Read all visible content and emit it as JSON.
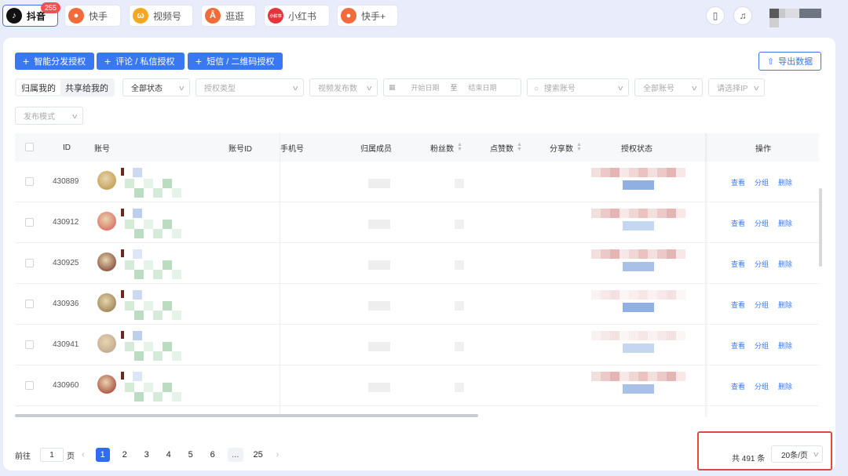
{
  "platforms": [
    {
      "label": "抖音",
      "icon": "douyin-icon",
      "badge": "255",
      "active": true,
      "color": "#111111"
    },
    {
      "label": "快手",
      "icon": "kuaishou-icon",
      "active": false,
      "color": "#f26b3a"
    },
    {
      "label": "视频号",
      "icon": "wechat-channels-icon",
      "active": false,
      "color": "#f5a623"
    },
    {
      "label": "逛逛",
      "icon": "guangguang-icon",
      "active": false,
      "color": "#f26b3a"
    },
    {
      "label": "小红书",
      "icon": "xiaohongshu-icon",
      "icon_text": "小红书",
      "active": false,
      "color": "#e8323c"
    },
    {
      "label": "快手+",
      "icon": "kuaishou-plus-icon",
      "active": false,
      "color": "#f26b3a"
    }
  ],
  "toolbar": {
    "btn_smart": "智能分发授权",
    "btn_comment": "评论 / 私信授权",
    "btn_sms": "短信 / 二维码授权",
    "export": "导出数据"
  },
  "filters": {
    "seg_mine": "归属我的",
    "seg_shared": "共享给我的",
    "status": "全部状态",
    "auth_type": "授权类型",
    "video_count": "视频发布数",
    "start_date": "开始日期",
    "to": "至",
    "end_date": "结束日期",
    "search": "搜索账号",
    "all_accounts": "全部账号",
    "ip": "请选择IP",
    "publish_mode": "发布模式"
  },
  "table": {
    "columns": {
      "id": "ID",
      "account": "账号",
      "account_id": "账号ID",
      "phone": "手机号",
      "member": "归属成员",
      "fans": "粉丝数",
      "likes": "点赞数",
      "shares": "分享数",
      "auth_status": "授权状态",
      "actions": "操作"
    },
    "rows": [
      {
        "id": "430889",
        "avatar_color": "#b8903a"
      },
      {
        "id": "430912",
        "avatar_color": "#d9534f"
      },
      {
        "id": "430925",
        "avatar_color": "#6b2a1f"
      },
      {
        "id": "430936",
        "avatar_color": "#8a6d3b"
      },
      {
        "id": "430941",
        "avatar_color": "#b89a8a"
      },
      {
        "id": "430960",
        "avatar_color": "#9a2a22"
      }
    ],
    "action_view": "查看",
    "action_group": "分组",
    "action_delete": "删除"
  },
  "pagination": {
    "goto_label": "前往",
    "goto_value": "1",
    "page_unit": "页",
    "pages": [
      "1",
      "2",
      "3",
      "4",
      "5",
      "6"
    ],
    "ellipsis": "...",
    "last": "25",
    "current": "1",
    "total": "共 491 条",
    "page_size": "20条/页"
  }
}
